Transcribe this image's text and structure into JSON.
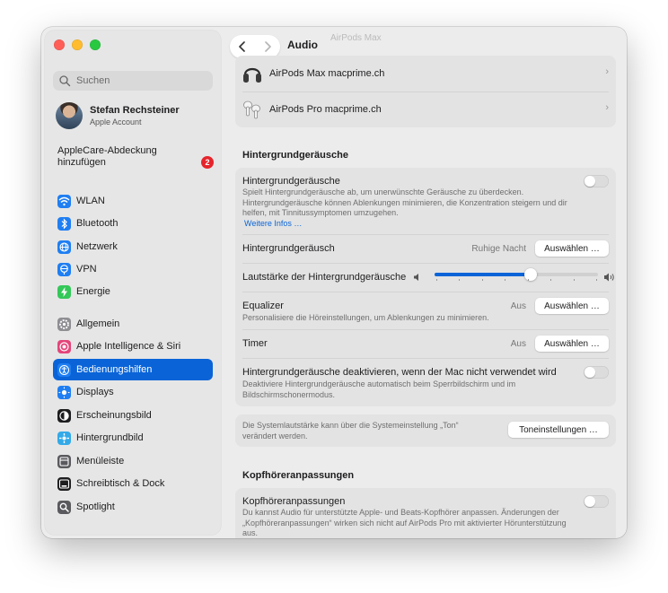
{
  "sidebar": {
    "search_placeholder": "Suchen",
    "account": {
      "name": "Stefan Rechsteiner",
      "subtitle": "Apple Account"
    },
    "applecare": {
      "label": "AppleCare-Abdeckung hinzufügen",
      "badge": "2"
    },
    "items": [
      {
        "label": "WLAN",
        "icon": "wifi-icon",
        "color": "#1f7ef2"
      },
      {
        "label": "Bluetooth",
        "icon": "bluetooth-icon",
        "color": "#1f7ef2"
      },
      {
        "label": "Netzwerk",
        "icon": "globe-icon",
        "color": "#1f7ef2"
      },
      {
        "label": "VPN",
        "icon": "vpn-globe-icon",
        "color": "#1f7ef2"
      },
      {
        "label": "Energie",
        "icon": "battery-icon",
        "color": "#34c759"
      },
      {
        "label": "Allgemein",
        "icon": "gear-icon",
        "color": "#8e8e93"
      },
      {
        "label": "Apple Intelligence & Siri",
        "icon": "siri-icon",
        "color": "#e3457a"
      },
      {
        "label": "Bedienungshilfen",
        "icon": "accessibility-icon",
        "color": "#1f7ef2"
      },
      {
        "label": "Displays",
        "icon": "sun-icon",
        "color": "#1f7ef2"
      },
      {
        "label": "Erscheinungsbild",
        "icon": "appearance-icon",
        "color": "#1d1d1f"
      },
      {
        "label": "Hintergrundbild",
        "icon": "wallpaper-icon",
        "color": "#33a9e8"
      },
      {
        "label": "Menüleiste",
        "icon": "menubar-icon",
        "color": "#5a5a5e"
      },
      {
        "label": "Schreibtisch & Dock",
        "icon": "dock-icon",
        "color": "#1d1d1f"
      },
      {
        "label": "Spotlight",
        "icon": "spotlight-icon",
        "color": "#5a5a5e"
      }
    ],
    "selected_index": 7
  },
  "header": {
    "title": "Audio",
    "ghost": "AirPods Max"
  },
  "devices": [
    {
      "name": "AirPods Max macprime.ch",
      "icon": "airpods-max-icon"
    },
    {
      "name": "AirPods Pro macprime.ch",
      "icon": "airpods-pro-icon"
    }
  ],
  "background_sounds": {
    "section_title": "Hintergrundgeräusche",
    "toggle_title": "Hintergrundgeräusche",
    "toggle_desc": "Spielt Hintergrundgeräusche ab, um unerwünschte Geräusche zu überdecken. Hintergrundgeräusche können Ablenkungen minimieren, die Konzentration steigern und dir helfen, mit Tinnitussymptomen umzugehen.",
    "more_link": "Weitere Infos …",
    "sound_label": "Hintergrundgeräusch",
    "sound_value": "Ruhige Nacht",
    "choose_label": "Auswählen …",
    "volume_label": "Lautstärke der Hintergrundgeräusche",
    "volume_level": 0.59,
    "equalizer_label": "Equalizer",
    "equalizer_desc": "Personalisiere die Höreinstellungen, um Ablenkungen zu minimieren.",
    "equalizer_value": "Aus",
    "timer_label": "Timer",
    "timer_value": "Aus",
    "deactivate_label": "Hintergrundgeräusche deaktivieren, wenn der Mac nicht verwendet wird",
    "deactivate_desc": "Deaktiviere Hintergrundgeräusche automatisch beim Sperrbildschirm und im Bildschirmschonermodus."
  },
  "system_volume": {
    "text": "Die Systemlautstärke kann über die Systemeinstellung „Ton“ verändert werden.",
    "button": "Toneinstellungen …"
  },
  "headphone": {
    "section_title": "Kopfhöreranpassungen",
    "toggle_title": "Kopfhöreranpassungen",
    "toggle_desc": "Du kannst Audio für unterstützte Apple- und Beats-Kopfhörer anpassen. Änderungen der „Kopfhöreranpassungen“ wirken sich nicht auf AirPods Pro mit aktivierter Hörunterstützung aus."
  }
}
